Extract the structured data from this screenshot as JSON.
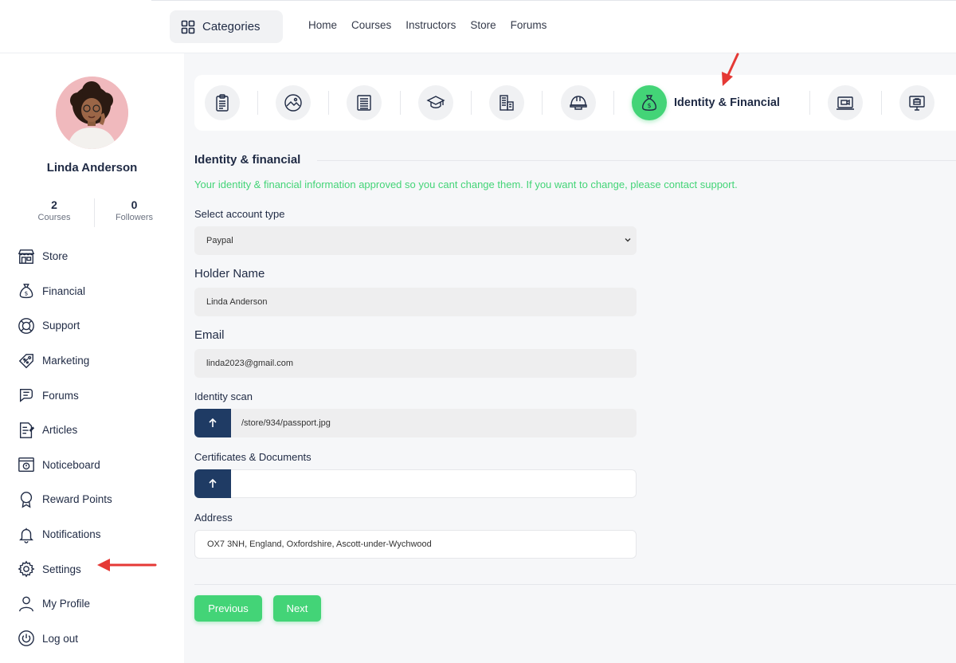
{
  "navbar": {
    "categories_label": "Categories",
    "links": [
      "Home",
      "Courses",
      "Instructors",
      "Store",
      "Forums"
    ]
  },
  "profile": {
    "name": "Linda Anderson",
    "courses_count": "2",
    "courses_label": "Courses",
    "followers_count": "0",
    "followers_label": "Followers"
  },
  "sidebar": {
    "items": [
      {
        "label": "Store",
        "icon": "store-icon"
      },
      {
        "label": "Financial",
        "icon": "money-bag-icon"
      },
      {
        "label": "Support",
        "icon": "lifebuoy-icon"
      },
      {
        "label": "Marketing",
        "icon": "tag-icon"
      },
      {
        "label": "Forums",
        "icon": "chat-icon"
      },
      {
        "label": "Articles",
        "icon": "article-icon"
      },
      {
        "label": "Noticeboard",
        "icon": "noticeboard-icon"
      },
      {
        "label": "Reward Points",
        "icon": "award-icon"
      },
      {
        "label": "Notifications",
        "icon": "bell-icon"
      },
      {
        "label": "Settings",
        "icon": "gear-icon"
      },
      {
        "label": "My Profile",
        "icon": "user-icon"
      },
      {
        "label": "Log out",
        "icon": "power-icon"
      }
    ]
  },
  "steps": {
    "active_label": "Identity & Financial",
    "icons": [
      "clipboard-icon",
      "image-icon",
      "document-icon",
      "graduation-cap-icon",
      "building-icon",
      "helmet-icon",
      "money-bag-icon",
      "video-icon",
      "briefcase-monitor-icon"
    ]
  },
  "form": {
    "section_title": "Identity & financial",
    "notice": "Your identity & financial information approved so you cant change them. If you want to change, please contact support.",
    "account_type_label": "Select account type",
    "account_type_value": "Paypal",
    "holder_name_label": "Holder Name",
    "holder_name_value": "Linda Anderson",
    "email_label": "Email",
    "email_value": "linda2023@gmail.com",
    "identity_scan_label": "Identity scan",
    "identity_scan_value": "/store/934/passport.jpg",
    "certificates_label": "Certificates & Documents",
    "certificates_value": "",
    "address_label": "Address",
    "address_value": "OX7 3NH, England, Oxfordshire, Ascott-under-Wychwood"
  },
  "buttons": {
    "previous": "Previous",
    "next": "Next"
  },
  "colors": {
    "primary": "#43d477",
    "dark_blue": "#1f3b64",
    "annotation_arrow": "#e53935"
  }
}
